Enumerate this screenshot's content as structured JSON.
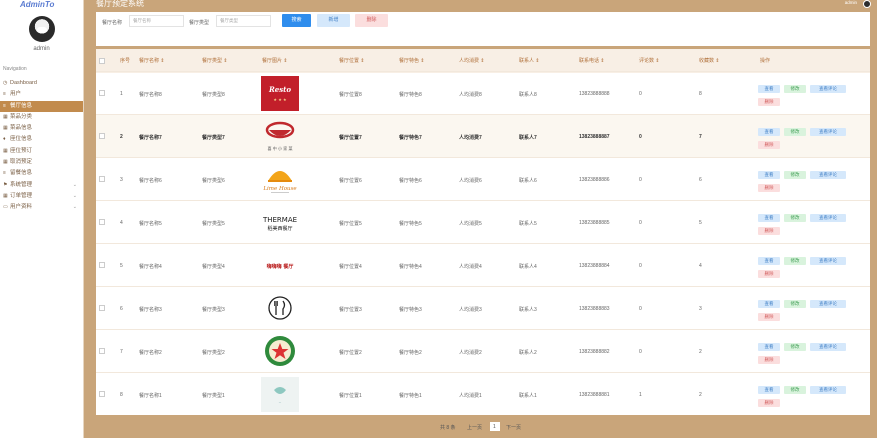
{
  "sidebar": {
    "logo": "AdminTo",
    "username": "admin",
    "nav_heading": "Navigation",
    "items": [
      {
        "label": "Dashboard",
        "icon": "clock-icon",
        "glyph": "◷"
      },
      {
        "label": "用户",
        "icon": "list-icon",
        "glyph": "≡"
      },
      {
        "label": "餐厅信息",
        "icon": "list-icon",
        "glyph": "≡",
        "active": true
      },
      {
        "label": "菜品分类",
        "icon": "grid-icon",
        "glyph": "▦"
      },
      {
        "label": "菜品信息",
        "icon": "grid-icon",
        "glyph": "▦"
      },
      {
        "label": "座位信息",
        "icon": "pin-icon",
        "glyph": "♦"
      },
      {
        "label": "座位预订",
        "icon": "grid-icon",
        "glyph": "▦"
      },
      {
        "label": "取消预定",
        "icon": "grid-icon",
        "glyph": "▦"
      },
      {
        "label": "留餐信息",
        "icon": "list-icon",
        "glyph": "≡"
      },
      {
        "label": "系统管理",
        "icon": "flag-icon",
        "glyph": "⚑",
        "chevron": true
      },
      {
        "label": "订单管理",
        "icon": "grid-icon",
        "glyph": "▦",
        "chevron": true
      },
      {
        "label": "用户资料",
        "icon": "folder-icon",
        "glyph": "▭",
        "chevron": true
      }
    ]
  },
  "header": {
    "title": "餐厅预定系统",
    "admin_name": "admin"
  },
  "search": {
    "name_label": "餐厅名称",
    "name_placeholder": "餐厅名称",
    "type_label": "餐厅类型",
    "type_placeholder": "餐厅类型",
    "search_button": "搜索",
    "add_button": "新增",
    "delete_button": "删除"
  },
  "table": {
    "columns": [
      "序号",
      "餐厅名称 ⇕",
      "餐厅类型 ⇕",
      "餐厅图片 ⇕",
      "餐厅位置 ⇕",
      "餐厅特色 ⇕",
      "人均消费 ⇕",
      "联系人 ⇕",
      "联系电话 ⇕",
      "评论数 ⇕",
      "收藏数 ⇕",
      "操作"
    ],
    "actions": {
      "view": "查看",
      "edit": "修改",
      "review": "查看评论",
      "delete": "删除"
    },
    "rows": [
      {
        "idx": "1",
        "name": "餐厅名称8",
        "type": "餐厅类型8",
        "location": "餐厅位置8",
        "feature": "餐厅特色8",
        "avg": "人均消费8",
        "contact": "联系人8",
        "phone": "13823888888",
        "comments": "0",
        "favorites": "8",
        "logo": "red-logo"
      },
      {
        "idx": "2",
        "name": "餐厅名称7",
        "type": "餐厅类型7",
        "location": "餐厅位置7",
        "feature": "餐厅特色7",
        "avg": "人均消费7",
        "contact": "联系人7",
        "phone": "13823888887",
        "comments": "0",
        "favorites": "7",
        "logo": "bowl-logo",
        "logo_text": "喜 中 小 家 菜"
      },
      {
        "idx": "3",
        "name": "餐厅名称6",
        "type": "餐厅类型6",
        "location": "餐厅位置6",
        "feature": "餐厅特色6",
        "avg": "人均消费6",
        "contact": "联系人6",
        "phone": "13823888886",
        "comments": "0",
        "favorites": "6",
        "logo": "limehouse-logo",
        "logo_text": "Lime House"
      },
      {
        "idx": "4",
        "name": "餐厅名称5",
        "type": "餐厅类型5",
        "location": "餐厅位置5",
        "feature": "餐厅特色5",
        "avg": "人均消费5",
        "contact": "联系人5",
        "phone": "13823888885",
        "comments": "0",
        "favorites": "5",
        "logo": "thermae-logo",
        "logo_text": "THERMAE",
        "logo_sub": "稻美西餐厅"
      },
      {
        "idx": "5",
        "name": "餐厅名称4",
        "type": "餐厅类型4",
        "location": "餐厅位置4",
        "feature": "餐厅特色4",
        "avg": "人均消费4",
        "contact": "联系人4",
        "phone": "13823888884",
        "comments": "0",
        "favorites": "4",
        "logo": "red-text-logo",
        "logo_text": "嗨嗨嗨 餐厅"
      },
      {
        "idx": "6",
        "name": "餐厅名称3",
        "type": "餐厅类型3",
        "location": "餐厅位置3",
        "feature": "餐厅特色3",
        "avg": "人均消费3",
        "contact": "联系人3",
        "phone": "13823888883",
        "comments": "0",
        "favorites": "3",
        "logo": "cutlery-logo"
      },
      {
        "idx": "7",
        "name": "餐厅名称2",
        "type": "餐厅类型2",
        "location": "餐厅位置2",
        "feature": "餐厅特色2",
        "avg": "人均消费2",
        "contact": "联系人2",
        "phone": "13823888882",
        "comments": "0",
        "favorites": "2",
        "logo": "green-badge-logo"
      },
      {
        "idx": "8",
        "name": "餐厅名称1",
        "type": "餐厅类型1",
        "location": "餐厅位置1",
        "feature": "餐厅特色1",
        "avg": "人均消费1",
        "contact": "联系人1",
        "phone": "13823888881",
        "comments": "1",
        "favorites": "2",
        "logo": "pale-logo"
      }
    ]
  },
  "pagination": {
    "total": "共 8 条",
    "prev": "上一页",
    "page": "1",
    "next": "下一页"
  },
  "colors": {
    "accent": "#c28b4d",
    "background": "#c9a57a",
    "primary_button": "#2f8ded"
  }
}
